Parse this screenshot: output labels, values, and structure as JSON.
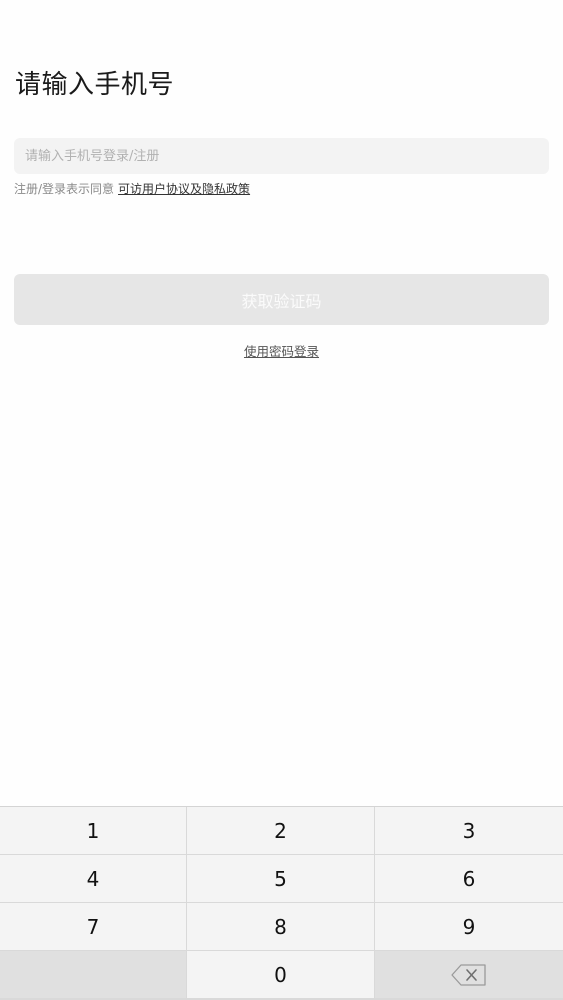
{
  "page": {
    "title": "请输入手机号"
  },
  "phone": {
    "placeholder": "请输入手机号登录/注册",
    "value": ""
  },
  "agreement": {
    "prefix": "注册/登录表示同意",
    "link": "可访用户协议及隐私政策"
  },
  "actions": {
    "get_code": "获取验证码",
    "password_login": "使用密码登录"
  },
  "keypad": {
    "keys": [
      "1",
      "2",
      "3",
      "4",
      "5",
      "6",
      "7",
      "8",
      "9",
      "0"
    ],
    "backspace_icon": "backspace-icon"
  },
  "colors": {
    "background": "#fefefe",
    "input_bg": "#f3f3f3",
    "button_disabled_bg": "#e6e6e6",
    "button_text": "#fbfbfb",
    "keypad_key": "#f4f4f4",
    "keypad_dark": "#e0e0e0"
  }
}
